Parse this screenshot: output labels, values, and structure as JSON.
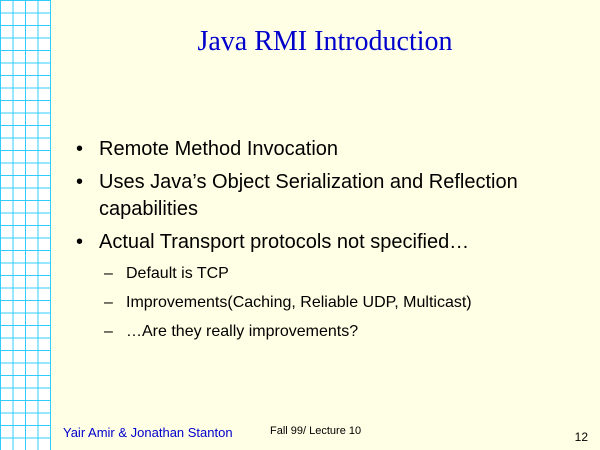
{
  "slide": {
    "title": "Java RMI Introduction",
    "bullets": [
      {
        "marker": "•",
        "text": "Remote Method Invocation"
      },
      {
        "marker": "•",
        "text": "Uses Java’s Object Serialization and Reflection capabilities"
      },
      {
        "marker": "•",
        "text": "Actual Transport protocols not specified…"
      }
    ],
    "subbullets": [
      {
        "marker": "–",
        "text": "Default is TCP"
      },
      {
        "marker": "–",
        "text": "Improvements(Caching, Reliable UDP, Multicast)"
      },
      {
        "marker": "–",
        "text": "…Are they really improvements?"
      }
    ],
    "footer": {
      "authors": "Yair Amir & Jonathan Stanton",
      "lecture": "Fall 99/ Lecture 10",
      "page": "12"
    }
  },
  "colors": {
    "background": "#ffffe5",
    "grid_line": "#33ccff",
    "title": "#0000cc",
    "authors": "#0000cc"
  }
}
